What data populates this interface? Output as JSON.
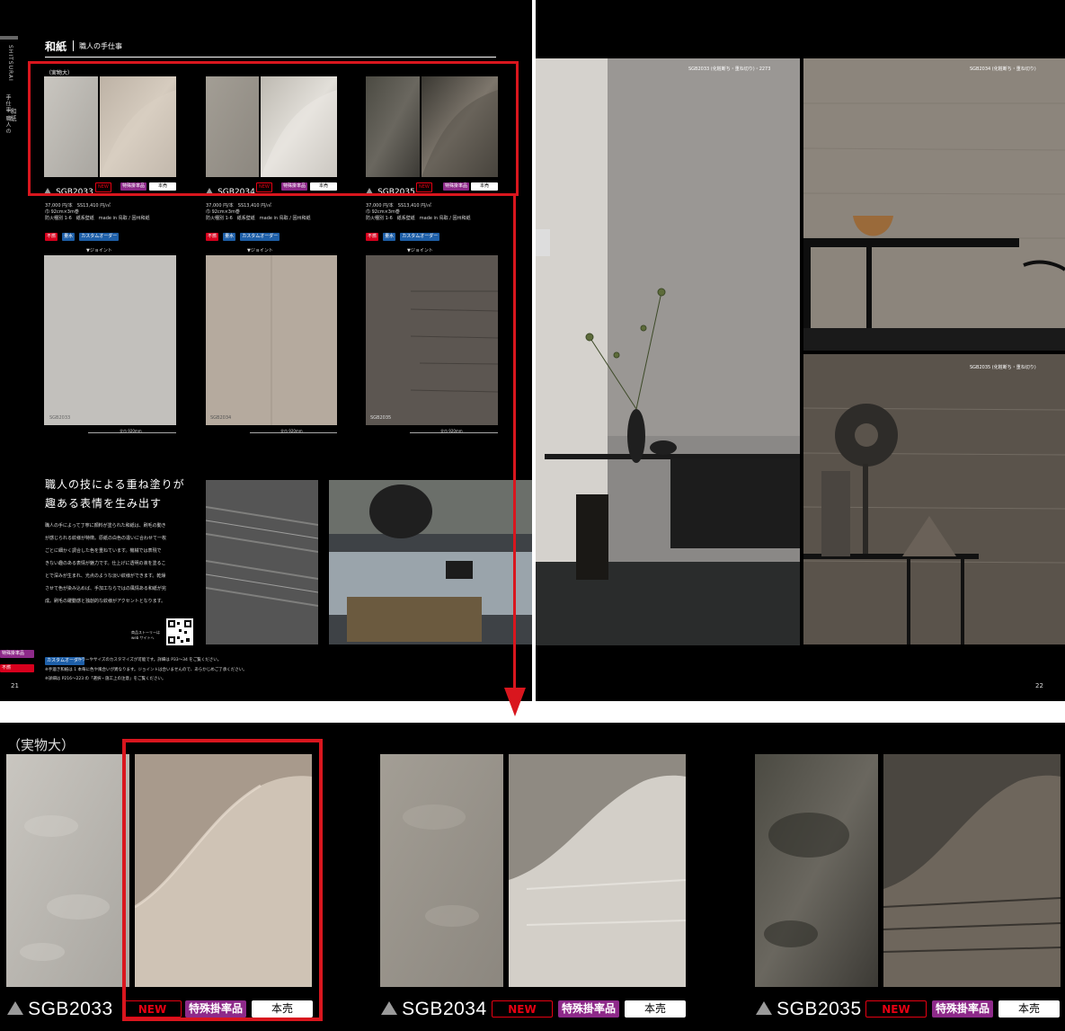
{
  "left_page": {
    "side_tab": "SHITSURAI",
    "side_tab2": "手仕事 職人の",
    "side_tab3": "和紙",
    "header_title": "和紙",
    "header_sub": "職人の手仕事",
    "actual_size": "（実物大）",
    "products": [
      {
        "code": "SGB2033",
        "new": "NEW",
        "special": "特殊掛率品",
        "honbai": "本売",
        "price": "37,000 円/本　SS13,410 円/㎡",
        "size": "巾 92cm×3m巻",
        "spec": "防火種別 1-6　紙系壁紙　made in 鳥取 / 因州和紙",
        "tags": [
          "不燃",
          "量水",
          "カスタムオーダー"
        ],
        "joint": "▼ジョイント",
        "swatch_label": "SGB2033",
        "scale": "全巾 920mm"
      },
      {
        "code": "SGB2034",
        "new": "NEW",
        "special": "特殊掛率品",
        "honbai": "本売",
        "price": "37,000 円/本　SS13,410 円/㎡",
        "size": "巾 92cm×3m巻",
        "spec": "防火種別 1-6　紙系壁紙　made in 鳥取 / 因州和紙",
        "tags": [
          "不燃",
          "量水",
          "カスタムオーダー"
        ],
        "joint": "▼ジョイント",
        "swatch_label": "SGB2034",
        "scale": "全巾 920mm"
      },
      {
        "code": "SGB2035",
        "new": "NEW",
        "special": "特殊掛率品",
        "honbai": "本売",
        "price": "37,000 円/本　SS13,410 円/㎡",
        "size": "巾 92cm×3m巻",
        "spec": "防火種別 1-6　紙系壁紙　made in 鳥取 / 因州和紙",
        "tags": [
          "不燃",
          "量水",
          "カスタムオーダー"
        ],
        "joint": "▼ジョイント",
        "swatch_label": "SGB2035",
        "scale": "全巾 920mm"
      }
    ],
    "headline_1": "職人の技による重ね塗りが",
    "headline_2": "趣ある表情を生み出す",
    "body_lines": [
      "職人の手によって丁寧に顔料が塗られた和紙は、刷毛の動き",
      "が感じられる紋様が特徴。原紙の白色の違いに合わせて一枚",
      "ごとに細かく調合した色を重ねています。機械では表現で",
      "きない趣のある表情が魅力です。仕上げに透明の液を塗るこ",
      "とで深みが生まれ、光点のような淡い紋様ができます。乾燥",
      "させて色が染み込めば、手加工ならではの風情ある和紙が完",
      "成。刷毛の躍動感と独創的な紋様がアクセントとなります。"
    ],
    "qr_caption": "商品ストーリーは web サイトへ",
    "legend_special": "特殊掛率品",
    "legend_fire": "不燃",
    "footer_tag": "カスタムオーダー",
    "footer_line1": "カラーやサイズのカスタマイズが可能です。詳細は P33～34 をご覧ください。",
    "footer_line2": "※手漉き和紙は 1 本毎に色や風合いが異なります。ジョイントは合いませんので、あらかじめご了承ください。",
    "footer_line3": "※詳細は P216～223 の「選択・施工上の注意」をご覧ください。",
    "page_number": "21"
  },
  "right_page": {
    "caption_1": "SGB2033 (化粧断ち・重ね切り)・2273",
    "caption_2": "SGB2034 (化粧断ち・重ね切り)",
    "caption_3": "SGB2035 (化粧断ち・重ね切り)",
    "page_number": "22"
  },
  "zoom": {
    "actual_size": "（実物大）",
    "products": [
      {
        "code": "SGB2033",
        "new": "NEW",
        "special": "特殊掛率品",
        "honbai": "本売"
      },
      {
        "code": "SGB2034",
        "new": "NEW",
        "special": "特殊掛率品",
        "honbai": "本売"
      },
      {
        "code": "SGB2035",
        "new": "NEW",
        "special": "特殊掛率品",
        "honbai": "本売"
      }
    ]
  },
  "colors": {
    "highlight": "#d9161e",
    "new_red": "#e60012",
    "special_purple": "#8e2a8a",
    "tag_red": "#d7001d",
    "tag_blue": "#1e5fa8"
  }
}
